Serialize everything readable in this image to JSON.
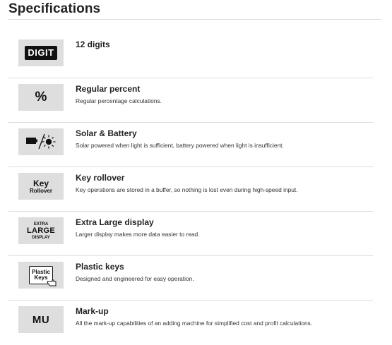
{
  "page": {
    "title": "Specifications"
  },
  "specs": [
    {
      "icon": "digit-icon",
      "icon_text": "DIGIT",
      "title": "12 digits",
      "description": ""
    },
    {
      "icon": "percent-icon",
      "icon_text": "%",
      "title": "Regular percent",
      "description": "Regular percentage calculations."
    },
    {
      "icon": "solar-battery-icon",
      "title": "Solar & Battery",
      "description": "Solar powered when light is sufficient, battery powered when light is insufficient."
    },
    {
      "icon": "key-rollover-icon",
      "icon_text_line1": "Key",
      "icon_text_line2": "Rollover",
      "title": "Key rollover",
      "description": "Key operations are stored in a buffer, so nothing is lost even during high-speed input."
    },
    {
      "icon": "extra-large-display-icon",
      "icon_text_line1": "EXTRA",
      "icon_text_line2": "LARGE",
      "icon_text_line3": "DISPLAY",
      "title": "Extra Large display",
      "description": "Larger display makes more data easier to read."
    },
    {
      "icon": "plastic-keys-icon",
      "icon_text_line1": "Plastic",
      "icon_text_line2": "Keys",
      "title": "Plastic keys",
      "description": "Designed and engineered for easy operation."
    },
    {
      "icon": "mark-up-icon",
      "icon_text": "MU",
      "title": "Mark-up",
      "description": "All the mark-up capabilities of an adding machine for simplified cost and profit calculations."
    }
  ],
  "colors": {
    "text": "#222222",
    "divider": "#dddddd",
    "icon_bg": "#dedede",
    "icon_fg": "#111111"
  }
}
